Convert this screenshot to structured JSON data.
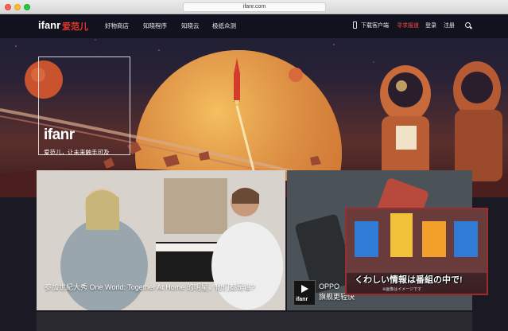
{
  "browser": {
    "url": "ifanr.com"
  },
  "nav": {
    "logo": "ifanr",
    "logo_cn": "爱范儿",
    "links": [
      "好物商店",
      "知晓程序",
      "知晓云",
      "极纸众测"
    ],
    "download": "下载客户端",
    "report": "寻求报道",
    "login": "登录",
    "register": "注册"
  },
  "hero": {
    "brand": "ifanr",
    "tagline": "爱范儿，让未来触手可及"
  },
  "cards": [
    {
      "title": "参加世紀大秀 One World: Together At Home 的明星，他们都是谁?"
    },
    {
      "title": "OPPO",
      "subtitle": "旗舰更轻快",
      "badge": "ifanr"
    }
  ],
  "ad": {
    "caption": "くわしい情報は番組の中で!",
    "small": "※画像はイメージです"
  },
  "colors": {
    "brand_red": "#e8352a",
    "report_red": "#ff4a3d"
  }
}
